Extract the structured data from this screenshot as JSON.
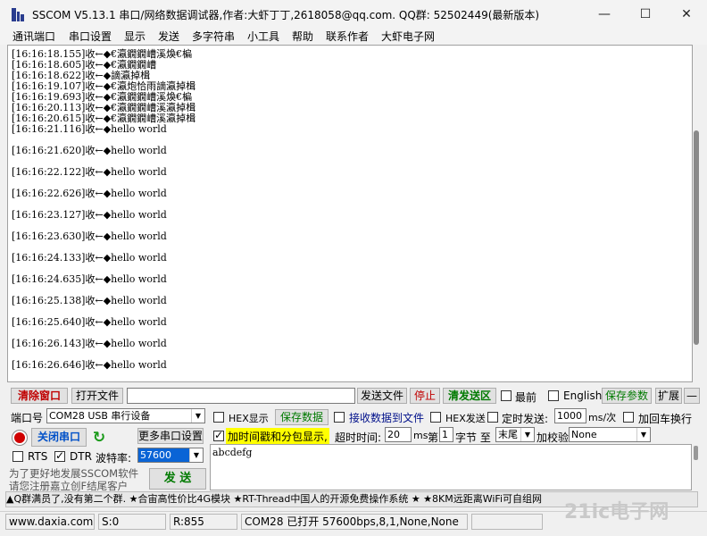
{
  "window": {
    "title": "SSCOM V5.13.1 串口/网络数据调试器,作者:大虾丁丁,2618058@qq.com. QQ群:  52502449(最新版本)",
    "minimize": "—",
    "maximize": "☐",
    "close": "✕"
  },
  "menu": [
    "通讯端口",
    "串口设置",
    "显示",
    "发送",
    "多字符串",
    "小工具",
    "帮助",
    "联系作者",
    "大虾电子网"
  ],
  "log_lines": [
    "[16:16:18.155]收←◆€瀛鐗鐗嶆溪煥€楄",
    "[16:16:18.605]收←◆€瀛鐗鐗嶆",
    "[16:16:18.622]收←◆謫瀛掉楫",
    "[16:16:19.107]收←◆€瀛炮恰雨謫瀛掉楫",
    "[16:16:19.693]收←◆€瀛鐗鐗嶆溪煥€楄",
    "[16:16:20.113]收←◆€瀛鐗鐗嶆溪瀛掉楫",
    "[16:16:20.615]收←◆€瀛鐗鐗嶆溪瀛掉楫",
    "[16:16:21.116]收←◆hello world",
    "[16:16:21.620]收←◆hello world",
    "[16:16:22.122]收←◆hello world",
    "[16:16:22.626]收←◆hello world",
    "[16:16:23.127]收←◆hello world",
    "[16:16:23.630]收←◆hello world",
    "[16:16:24.133]收←◆hello world",
    "[16:16:24.635]收←◆hello world",
    "[16:16:25.138]收←◆hello world",
    "[16:16:25.640]收←◆hello world",
    "[16:16:26.143]收←◆hello world",
    "[16:16:26.646]收←◆hello world"
  ],
  "toolbar": {
    "clear_window": "清除窗口",
    "open_file": "打开文件",
    "send_file": "发送文件",
    "stop": "停止",
    "clear_send": "清发送区",
    "last": "最前",
    "english": "English",
    "save_params": "保存参数",
    "expand": "扩展",
    "collapse": "—"
  },
  "port": {
    "label": "端口号",
    "value": "COM28 USB 串行设备",
    "close_port": "关闭串口",
    "more_settings": "更多串口设置",
    "rts": "RTS",
    "dtr": "DTR",
    "baud_label": "波特率:",
    "baud_value": "57600",
    "promo1": "为了更好地发展SSCOM软件",
    "promo2": "请您注册嘉立创F结尾客户",
    "send": "发  送"
  },
  "options": {
    "hex_display": "HEX显示",
    "save_data": "保存数据",
    "recv_to_file": "接收数据到文件",
    "hex_send": "HEX发送",
    "timed_send": "定时发送:",
    "interval": "1000",
    "interval_unit": "ms/次",
    "add_crlf": "加回车换行",
    "timestamp": "加时间戳和分包显示,",
    "timeout_label": "超时时间:",
    "timeout": "20",
    "ms": "ms",
    "nth": "第",
    "byte_index": "1",
    "byte_label": "字节 至",
    "end": "末尾",
    "checksum_label": "加校验",
    "checksum": "None"
  },
  "send_text": "abcdefg",
  "ticker": "▲Q群满员了,没有第二个群. ★合宙高性价比4G模块 ★RT-Thread中国人的开源免费操作系统 ★ ★8KM远距离WiFi可自组网",
  "statusbar": {
    "site": "www.daxia.com",
    "sent": "S:0",
    "received": "R:855",
    "port_status": "COM28 已打开  57600bps,8,1,None,None"
  },
  "watermark": "21ic电子网"
}
